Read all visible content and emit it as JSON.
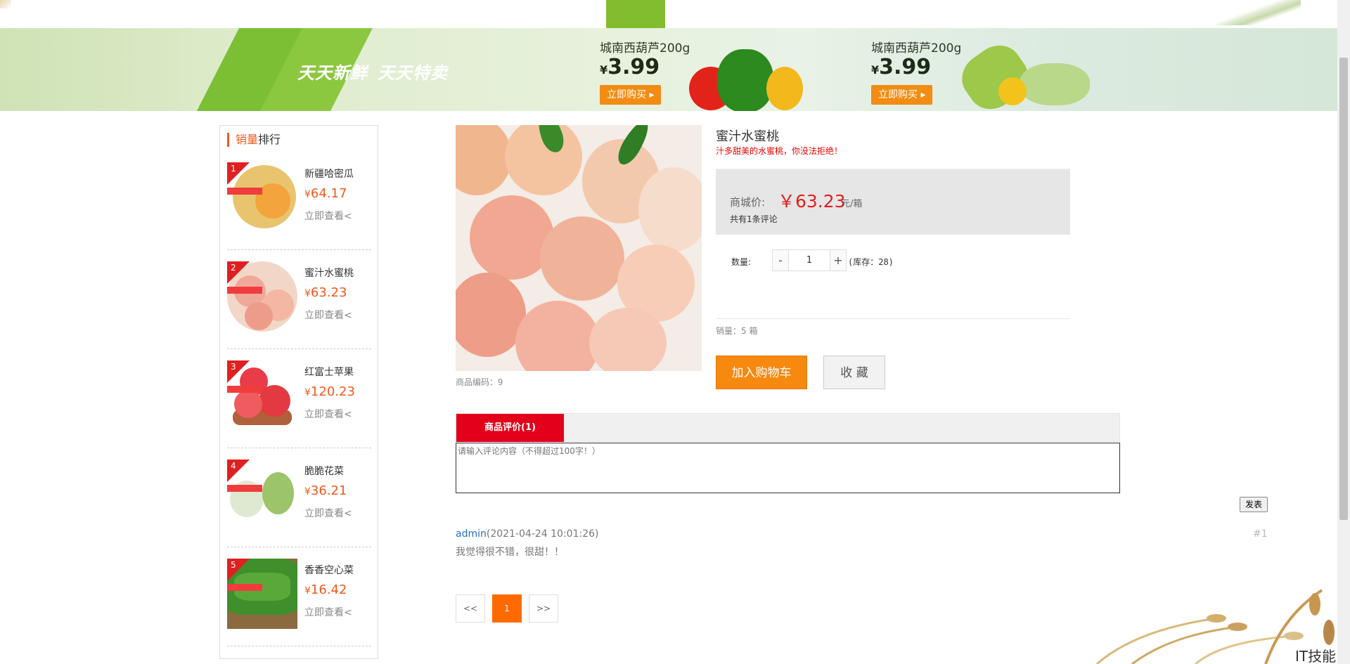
{
  "banner": {
    "slogan_left": "天天新鲜",
    "slogan_right": "天天特卖",
    "promos": [
      {
        "title": "城南西葫芦200g",
        "currency": "¥",
        "price": "3.99",
        "button": "立即购买"
      },
      {
        "title": "城南西葫芦200g",
        "currency": "¥",
        "price": "3.99",
        "button": "立即购买"
      }
    ]
  },
  "sidebar": {
    "title_highlight": "销量",
    "title_rest": "排行",
    "items": [
      {
        "rank": "1",
        "name": "新疆哈密瓜",
        "currency": "¥",
        "price": "64.17",
        "link": "立即查看<"
      },
      {
        "rank": "2",
        "name": "蜜汁水蜜桃",
        "currency": "¥",
        "price": "63.23",
        "link": "立即查看<"
      },
      {
        "rank": "3",
        "name": "红富士苹果",
        "currency": "¥",
        "price": "120.23",
        "link": "立即查看<"
      },
      {
        "rank": "4",
        "name": "脆脆花菜",
        "currency": "¥",
        "price": "36.21",
        "link": "立即查看<"
      },
      {
        "rank": "5",
        "name": "香香空心菜",
        "currency": "¥",
        "price": "16.42",
        "link": "立即查看<"
      }
    ]
  },
  "product": {
    "name": "蜜汁水蜜桃",
    "subtitle": "汁多甜美的水蜜桃，你没法拒绝！",
    "code_label": "商品编码：",
    "code": "9",
    "price_label": "商城价:",
    "price": "￥63.23",
    "unit": "元/箱",
    "review_count_text": "共有1条评论",
    "qty_label": "数量:",
    "qty_minus": "-",
    "qty_value": "1",
    "qty_plus": "+",
    "stock_text": "(库存：28)",
    "sales_text": "销量：5 箱",
    "add_to_cart": "加入购物车",
    "favorite": "收 藏"
  },
  "reviews": {
    "tab_label": "商品评价(1)",
    "input_placeholder": "请输入评论内容（不得超过100字！）",
    "post_button": "发表",
    "comments": [
      {
        "user": "admin",
        "time": "(2021-04-24 10:01:26)",
        "body": "我觉得很不错，很甜！！",
        "num": "#1"
      }
    ]
  },
  "pager": {
    "prev": "<<",
    "current": "1",
    "next": ">>"
  },
  "watermark": "IT技能网",
  "colors": {
    "accent_orange": "#f8890f",
    "accent_red": "#e3001b",
    "brand_green": "#82bd2f",
    "price_orange": "#f05a1e"
  }
}
